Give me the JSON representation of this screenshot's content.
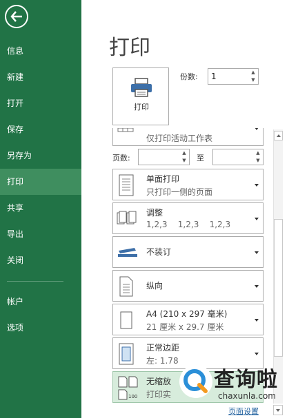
{
  "title": "打印",
  "sidebar": {
    "items": [
      {
        "label": "信息",
        "active": false
      },
      {
        "label": "新建",
        "active": false
      },
      {
        "label": "打开",
        "active": false
      },
      {
        "label": "保存",
        "active": false
      },
      {
        "label": "另存为",
        "active": false
      },
      {
        "label": "打印",
        "active": true
      },
      {
        "label": "共享",
        "active": false
      },
      {
        "label": "导出",
        "active": false
      },
      {
        "label": "关闭",
        "active": false
      },
      {
        "label": "帐户",
        "active": false
      },
      {
        "label": "选项",
        "active": false
      }
    ]
  },
  "print_button": {
    "label": "打印"
  },
  "copies": {
    "label": "份数:",
    "value": "1"
  },
  "settings": {
    "scope": {
      "subtitle": "仅打印活动工作表"
    },
    "pages": {
      "label": "页数:",
      "to": "至",
      "from_value": "",
      "to_value": ""
    },
    "sides": {
      "title": "单面打印",
      "subtitle": "只打印一侧的页面"
    },
    "collate": {
      "title": "调整",
      "subtitle": "1,2,3    1,2,3    1,2,3"
    },
    "staple": {
      "title": "不装订"
    },
    "orientation": {
      "title": "纵向"
    },
    "paper": {
      "title": "A4 (210 x 297 毫米)",
      "subtitle": "21 厘米 x 29.7 厘米"
    },
    "margins": {
      "title": "正常边距",
      "subtitle": "左: 1.78"
    },
    "scaling": {
      "title": "无缩放",
      "subtitle": "打印实"
    }
  },
  "page_setup_link": "页面设置",
  "watermark": {
    "text": "查询啦",
    "url": "chaxunla.com"
  },
  "colors": {
    "sidebar": "#217346",
    "sidebar_active": "#3f8e5f",
    "link": "#1e5f9e"
  }
}
